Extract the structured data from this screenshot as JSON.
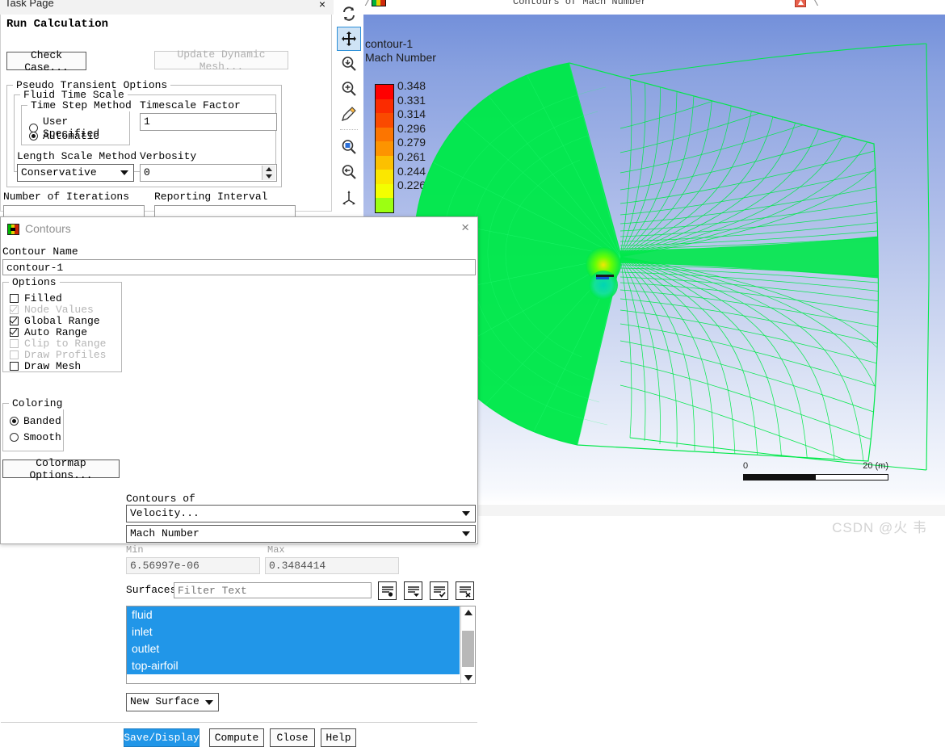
{
  "task_page": {
    "titlebar": {
      "title": "Task Page",
      "close": "×"
    },
    "heading": "Run Calculation",
    "buttons": {
      "check_case": "Check Case...",
      "update_dynamic_mesh": "Update Dynamic Mesh..."
    },
    "pseudo_transient": {
      "legend": "Pseudo Transient Options",
      "fluid_time_scale": {
        "legend": "Fluid Time Scale",
        "time_step_method": {
          "legend": "Time Step Method",
          "options": [
            "User Specified",
            "Automatic"
          ],
          "selected": "Automatic"
        },
        "timescale_factor": {
          "label": "Timescale Factor",
          "value": "1"
        },
        "length_scale_method": {
          "label": "Length Scale Method",
          "value": "Conservative"
        },
        "verbosity": {
          "label": "Verbosity",
          "value": "0"
        }
      }
    },
    "iterations": {
      "label": "Number of Iterations",
      "reporting_label": "Reporting Interval"
    }
  },
  "toolbar": {
    "items": [
      {
        "name": "rotate-icon",
        "title": "Rotate"
      },
      {
        "name": "pan-icon",
        "title": "Pan",
        "selected": true
      },
      {
        "name": "zoom-to-fit-icon",
        "title": "Fit to Window"
      },
      {
        "name": "zoom-in-icon",
        "title": "Zoom In"
      },
      {
        "name": "probe-icon",
        "title": "Probe"
      },
      {
        "name": "zoom-to-region-icon",
        "title": "Zoom to Region"
      },
      {
        "name": "zoom-out-icon",
        "title": "Zoom Out"
      },
      {
        "name": "axes-icon",
        "title": "Axes"
      }
    ]
  },
  "graphics": {
    "tab_title": "Contours of Mach Number",
    "overlay": {
      "line1": "contour-1",
      "line2": "Mach Number"
    },
    "scale_bar": {
      "min": "0",
      "max": "20 (m)"
    },
    "watermark": "CSDN @火 韦"
  },
  "chart_data": {
    "type": "heatmap",
    "title": "Contours of Mach Number",
    "subtitle": "contour-1",
    "variable": "Mach Number",
    "colorbar_labels": [
      "0.348",
      "0.331",
      "0.314",
      "0.296",
      "0.279",
      "0.261",
      "0.244",
      "0.226"
    ],
    "colorbar_colors": [
      "#ff0000",
      "#fb2b00",
      "#fa4a00",
      "#fc7500",
      "#fd9400",
      "#fcc000",
      "#fbe700",
      "#f3ff00",
      "#9cff12"
    ],
    "range": {
      "min": "6.56997e-06",
      "max": "0.3484414"
    },
    "mesh_color": "#00e84a",
    "background_gradient": [
      "#7390da",
      "#ffffff"
    ],
    "scale_units": "m",
    "scale_length": 20
  },
  "contours_dialog": {
    "title": "Contours",
    "close": "×",
    "contour_name": {
      "label": "Contour Name",
      "value": "contour-1"
    },
    "options": {
      "legend": "Options",
      "items": [
        {
          "label": "Filled",
          "checked": false,
          "enabled": true
        },
        {
          "label": "Node Values",
          "checked": true,
          "enabled": false
        },
        {
          "label": "Global Range",
          "checked": true,
          "enabled": true
        },
        {
          "label": "Auto Range",
          "checked": true,
          "enabled": true
        },
        {
          "label": "Clip to Range",
          "checked": false,
          "enabled": false
        },
        {
          "label": "Draw Profiles",
          "checked": false,
          "enabled": false
        },
        {
          "label": "Draw Mesh",
          "checked": false,
          "enabled": true
        }
      ]
    },
    "coloring": {
      "legend": "Coloring",
      "options": [
        "Banded",
        "Smooth"
      ],
      "selected": "Banded"
    },
    "colormap_options_button": "Colormap Options...",
    "contours_of": {
      "label": "Contours of",
      "category": "Velocity...",
      "variable": "Mach Number"
    },
    "min": {
      "label": "Min",
      "value": "6.56997e-06"
    },
    "max": {
      "label": "Max",
      "value": "0.3484414"
    },
    "surfaces": {
      "label": "Surfaces",
      "filter_placeholder": "Filter Text",
      "items": [
        "fluid",
        "inlet",
        "outlet",
        "top-airfoil"
      ],
      "actions": [
        "select-none-icon",
        "select-filtered-icon",
        "select-all-icon",
        "deselect-all-icon"
      ]
    },
    "new_surface_button": "New Surface",
    "footer_buttons": [
      "Save/Display",
      "Compute",
      "Close",
      "Help"
    ]
  }
}
